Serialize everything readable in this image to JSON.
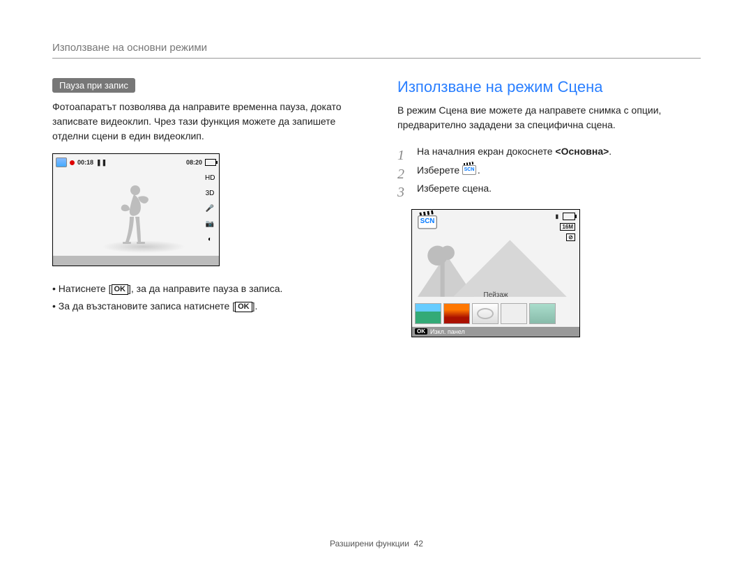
{
  "header": {
    "title": "Използване на основни режими"
  },
  "left": {
    "pill": "Пауза при запис",
    "paragraph": "Фотоапаратът позволява да направите временна пауза, докато записвате видеоклип. Чрез тази функция можете да запишете отделни сцени в един видеоклип.",
    "shot": {
      "time_elapsed": "00:18",
      "time_total": "08:20",
      "side_icons": [
        "HD",
        "3D",
        "mic-icon",
        "camera-icon",
        "focus-icon"
      ]
    },
    "bullets": {
      "b1_before": "Натиснете [",
      "b1_ok": "OK",
      "b1_after": "], за да направите пауза в записа.",
      "b2_before": "За да възстановите записа натиснете [",
      "b2_ok": "OK",
      "b2_after": "]."
    }
  },
  "right": {
    "section_title": "Използване на режим Сцена",
    "intro": "В режим Сцена вие можете да направете снимка с опции, предварително зададени за специфична сцена.",
    "steps": {
      "s1_before": "На началния екран докоснете ",
      "s1_bold": "<Основна>",
      "s1_after": ".",
      "s2_before": "Изберете ",
      "s2_after": ".",
      "s3": "Изберете сцена."
    },
    "scene_shot": {
      "scn_label": "SCN",
      "size_badge": "16M",
      "flash_badge": "⊘",
      "landscape_label": "Пейзаж",
      "bottom_ok": "OK",
      "bottom_text": "Изкл. панел"
    }
  },
  "footer": {
    "text": "Разширени функции",
    "page": "42"
  }
}
